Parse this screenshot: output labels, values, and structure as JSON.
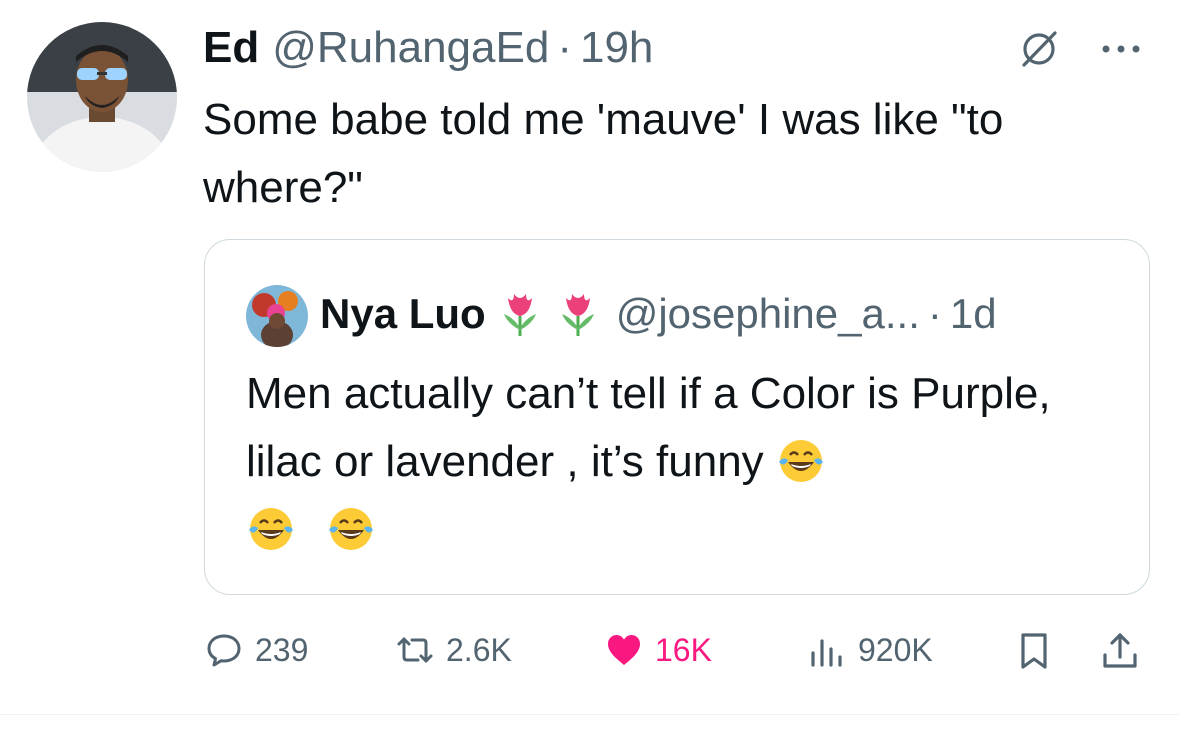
{
  "tweet": {
    "author_name": "Ed",
    "author_handle": "@RuhangaEd",
    "separator": "·",
    "time": "19h",
    "text": "Some babe told me 'mauve' I was like \"to where?\""
  },
  "quoted_tweet": {
    "author_name": "Nya Luo",
    "author_emojis": [
      "tulip-emoji",
      "tulip-emoji"
    ],
    "author_handle": "@josephine_a...",
    "separator": "·",
    "time": "1d",
    "text": "Men actually can’t tell if a Color is Purple, lilac or lavender , it’s funny",
    "trailing_emojis": [
      "face-with-tears-of-joy",
      "face-with-tears-of-joy",
      "face-with-tears-of-joy"
    ]
  },
  "actions": {
    "replies": "239",
    "reposts": "2.6K",
    "likes": "16K",
    "views": "920K"
  },
  "icons": [
    "grok-icon",
    "more-icon",
    "reply-icon",
    "repost-icon",
    "heart-icon",
    "views-icon",
    "bookmark-icon",
    "share-icon"
  ],
  "colors": {
    "text": "#0f1419",
    "secondary": "#536471",
    "like": "#f91880",
    "border": "#cfd9de"
  }
}
